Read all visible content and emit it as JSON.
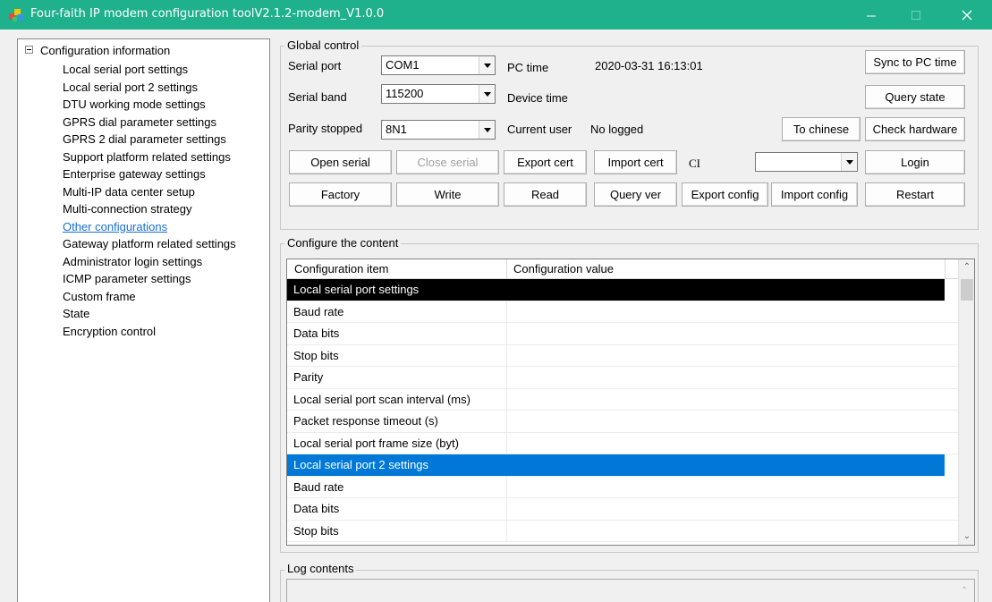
{
  "window": {
    "title": "Four-faith IP modem configuration toolV2.1.2-modem_V1.0.0",
    "title_color": "#1fb08c"
  },
  "tree": {
    "root": "Configuration information",
    "items": [
      {
        "label": "Local serial port settings"
      },
      {
        "label": "Local serial port 2 settings"
      },
      {
        "label": "DTU working mode settings"
      },
      {
        "label": "GPRS dial parameter settings"
      },
      {
        "label": "GPRS 2 dial parameter settings"
      },
      {
        "label": "Support platform related settings"
      },
      {
        "label": "Enterprise gateway settings"
      },
      {
        "label": "Multi-IP data center setup"
      },
      {
        "label": "Multi-connection strategy"
      },
      {
        "label": "Other configurations",
        "link": true
      },
      {
        "label": "Gateway platform related settings"
      },
      {
        "label": "Administrator login settings"
      },
      {
        "label": "ICMP parameter settings"
      },
      {
        "label": "Custom frame"
      },
      {
        "label": "State"
      },
      {
        "label": "Encryption control"
      }
    ]
  },
  "global": {
    "label": "Global control",
    "serial_port_label": "Serial port",
    "serial_port_value": "COM1",
    "serial_band_label": "Serial band",
    "serial_band_value": "115200",
    "parity_label": "Parity stopped",
    "parity_value": "8N1",
    "pc_time_label": "PC time",
    "pc_time_value": "2020-03-31 16:13:01",
    "device_time_label": "Device time",
    "current_user_label": "Current user",
    "current_user_value": "No logged",
    "ci_label": "CI",
    "ci_value": "",
    "buttons": {
      "sync": "Sync to PC time",
      "query_state": "Query state",
      "to_chinese": "To chinese",
      "check_hardware": "Check hardware",
      "open_serial": "Open serial",
      "close_serial": "Close serial",
      "export_cert": "Export cert",
      "import_cert": "Import cert",
      "login": "Login",
      "factory": "Factory",
      "write": "Write",
      "read": "Read",
      "query_ver": "Query ver",
      "export_config": "Export config",
      "import_config": "Import config",
      "restart": "Restart"
    }
  },
  "content": {
    "label": "Configure the content",
    "columns": [
      "Configuration item",
      "Configuration value"
    ],
    "rows": [
      {
        "item": "Local serial port settings",
        "value": "",
        "state": "selected-black"
      },
      {
        "item": "Baud rate",
        "value": ""
      },
      {
        "item": "Data bits",
        "value": ""
      },
      {
        "item": "Stop bits",
        "value": ""
      },
      {
        "item": "Parity",
        "value": ""
      },
      {
        "item": "Local serial port scan interval (ms)",
        "value": ""
      },
      {
        "item": "Packet response timeout (s)",
        "value": ""
      },
      {
        "item": "Local serial port frame size (byt)",
        "value": ""
      },
      {
        "item": "Local serial port 2 settings",
        "value": "",
        "state": "selected-blue"
      },
      {
        "item": "Baud rate",
        "value": ""
      },
      {
        "item": "Data bits",
        "value": ""
      },
      {
        "item": "Stop bits",
        "value": ""
      }
    ]
  },
  "log": {
    "label": "Log contents"
  }
}
